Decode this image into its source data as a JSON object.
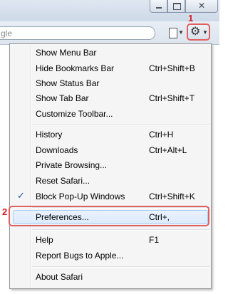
{
  "window": {
    "close_glyph": "✕"
  },
  "toolbar": {
    "search_text": "gle",
    "page_icon": "page-icon",
    "settings_icon": "gear-icon"
  },
  "callouts": {
    "first": "1",
    "second": "2"
  },
  "menu": {
    "items": [
      {
        "label": "Show Menu Bar",
        "shortcut": ""
      },
      {
        "label": "Hide Bookmarks Bar",
        "shortcut": "Ctrl+Shift+B"
      },
      {
        "label": "Show Status Bar",
        "shortcut": ""
      },
      {
        "label": "Show Tab Bar",
        "shortcut": "Ctrl+Shift+T"
      },
      {
        "label": "Customize Toolbar...",
        "shortcut": ""
      },
      {
        "label": "History",
        "shortcut": "Ctrl+H"
      },
      {
        "label": "Downloads",
        "shortcut": "Ctrl+Alt+L"
      },
      {
        "label": "Private Browsing...",
        "shortcut": ""
      },
      {
        "label": "Reset Safari...",
        "shortcut": ""
      },
      {
        "label": "Block Pop-Up Windows",
        "shortcut": "Ctrl+Shift+K",
        "checked": true
      },
      {
        "label": "Preferences...",
        "shortcut": "Ctrl+,",
        "highlighted": true
      },
      {
        "label": "Help",
        "shortcut": "F1"
      },
      {
        "label": "Report Bugs to Apple...",
        "shortcut": ""
      },
      {
        "label": "About Safari",
        "shortcut": ""
      }
    ],
    "check_glyph": "✓"
  },
  "colors": {
    "callout": "#d02020",
    "highlight_border": "#a8cbf3",
    "check": "#1a4f9c"
  }
}
